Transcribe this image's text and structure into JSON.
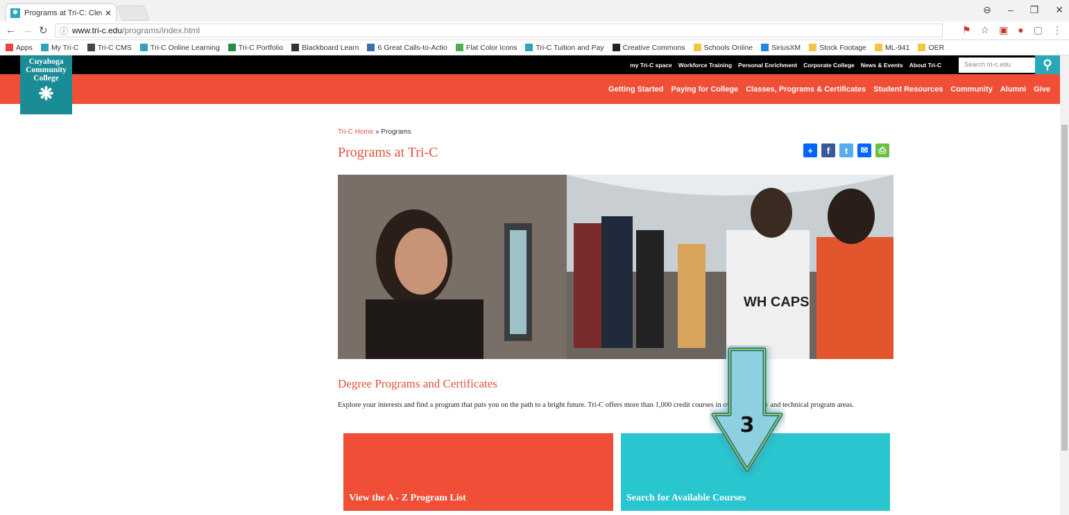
{
  "browser": {
    "tab_title": "Programs at Tri-C: Clevel",
    "url_host": "www.tri-c.edu",
    "url_path": "/programs/index.html",
    "bookmarks": [
      {
        "label": "Apps",
        "color": "#e8453c"
      },
      {
        "label": "My Tri-C",
        "color": "#2aa6b6"
      },
      {
        "label": "Tri-C CMS",
        "color": "#444"
      },
      {
        "label": "Tri-C Online Learning",
        "color": "#2aa6b6"
      },
      {
        "label": "Tri-C Portfolio",
        "color": "#2a8a4a"
      },
      {
        "label": "Blackboard Learn",
        "color": "#333"
      },
      {
        "label": "6 Great Calls-to-Actio",
        "color": "#3a6fb0"
      },
      {
        "label": "Flat Color Icons",
        "color": "#4caf50"
      },
      {
        "label": "Tri-C Tuition and Pay",
        "color": "#2aa6b6"
      },
      {
        "label": "Creative Commons",
        "color": "#222"
      },
      {
        "label": "Schools Online",
        "color": "#f4c542"
      },
      {
        "label": "SiriusXM",
        "color": "#1e88e5"
      },
      {
        "label": "Stock Footage",
        "color": "#f4c542"
      },
      {
        "label": "ML-941",
        "color": "#f4c542"
      },
      {
        "label": "OER",
        "color": "#f4c542"
      }
    ]
  },
  "site": {
    "logo_lines": [
      "Cuyahoga",
      "Community",
      "College"
    ],
    "utility_links": [
      "my Tri-C space",
      "Workforce Training",
      "Personal Enrichment",
      "Corporate College",
      "News & Events",
      "About Tri-C"
    ],
    "search_placeholder": "Search tri-c.edu",
    "main_nav": [
      "Getting Started",
      "Paying for College",
      "Classes, Programs & Certificates",
      "Student Resources",
      "Community",
      "Alumni",
      "Give"
    ],
    "breadcrumb_home": "Tri-C Home",
    "breadcrumb_sep": " » ",
    "breadcrumb_current": "Programs",
    "page_title": "Programs at Tri-C",
    "section_title": "Degree Programs and Certificates",
    "intro_text": "Explore your interests and find a program that puts you on the path to a bright future.  Tri-C offers more than 1,000 credit courses in over 140 career and technical program areas.",
    "tile_az": "View the A - Z Program List",
    "tile_search": "Search for Available Courses",
    "annotation_number": "3"
  },
  "colors": {
    "brand_red": "#f04e37",
    "brand_teal": "#2ac6d0",
    "logo_teal": "#1a8c95"
  }
}
